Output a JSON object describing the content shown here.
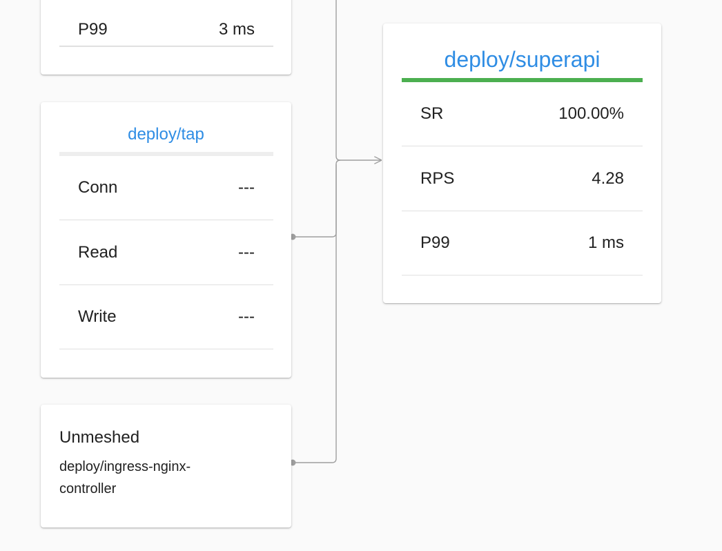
{
  "top_card": {
    "rows": [
      {
        "label": "P99",
        "value": "3 ms"
      }
    ]
  },
  "tap_card": {
    "title": "deploy/tap",
    "rows": [
      {
        "label": "Conn",
        "value": "---"
      },
      {
        "label": "Read",
        "value": "---"
      },
      {
        "label": "Write",
        "value": "---"
      }
    ]
  },
  "unmeshed_card": {
    "title": "Unmeshed",
    "name": "deploy/ingress-nginx-controller"
  },
  "superapi_card": {
    "title": "deploy/superapi",
    "rows": [
      {
        "label": "SR",
        "value": "100.00%"
      },
      {
        "label": "RPS",
        "value": "4.28"
      },
      {
        "label": "P99",
        "value": "1 ms"
      }
    ]
  },
  "colors": {
    "link": "#2f8de4",
    "success_bar": "#4caf50",
    "neutral_bar": "#eeeeee",
    "edge": "#9e9e9e"
  }
}
